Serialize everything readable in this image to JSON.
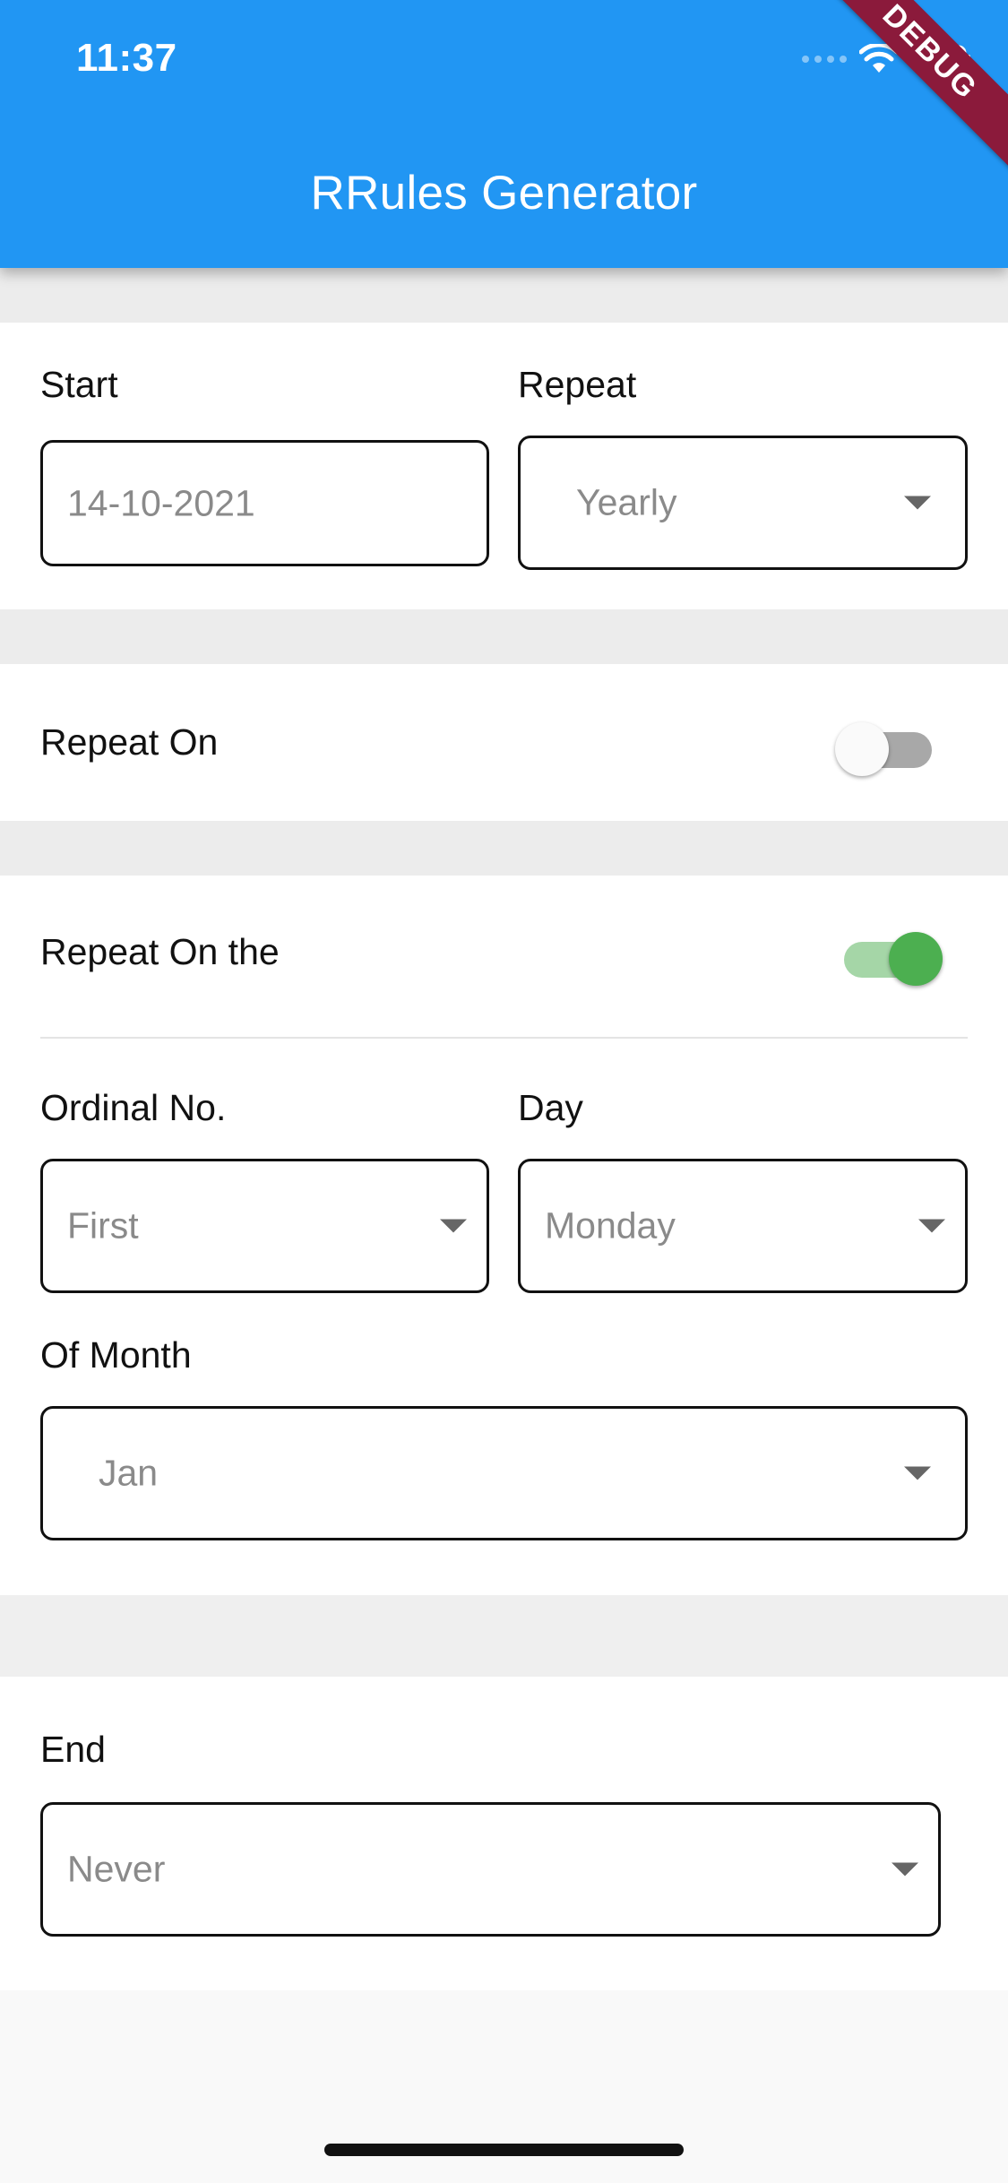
{
  "status_bar": {
    "time": "11:37"
  },
  "app_bar": {
    "title": "RRules Generator",
    "debug_label": "DEBUG"
  },
  "start_section": {
    "start_label": "Start",
    "start_date_value": "14-10-2021",
    "repeat_label": "Repeat",
    "repeat_value": "Yearly"
  },
  "repeat_on": {
    "label": "Repeat On",
    "enabled": false
  },
  "repeat_on_the": {
    "label": "Repeat On the",
    "enabled": true,
    "ordinal_label": "Ordinal No.",
    "ordinal_value": "First",
    "day_label": "Day",
    "day_value": "Monday",
    "month_label": "Of Month",
    "month_value": "Jan"
  },
  "end_section": {
    "label": "End",
    "value": "Never"
  },
  "colors": {
    "app_bar": "#2196f3",
    "switch_on": "#4caf50",
    "switch_on_track": "#a5d6a7",
    "switch_off_track": "#a8a8a8",
    "debug_banner": "#8b1a3b"
  }
}
